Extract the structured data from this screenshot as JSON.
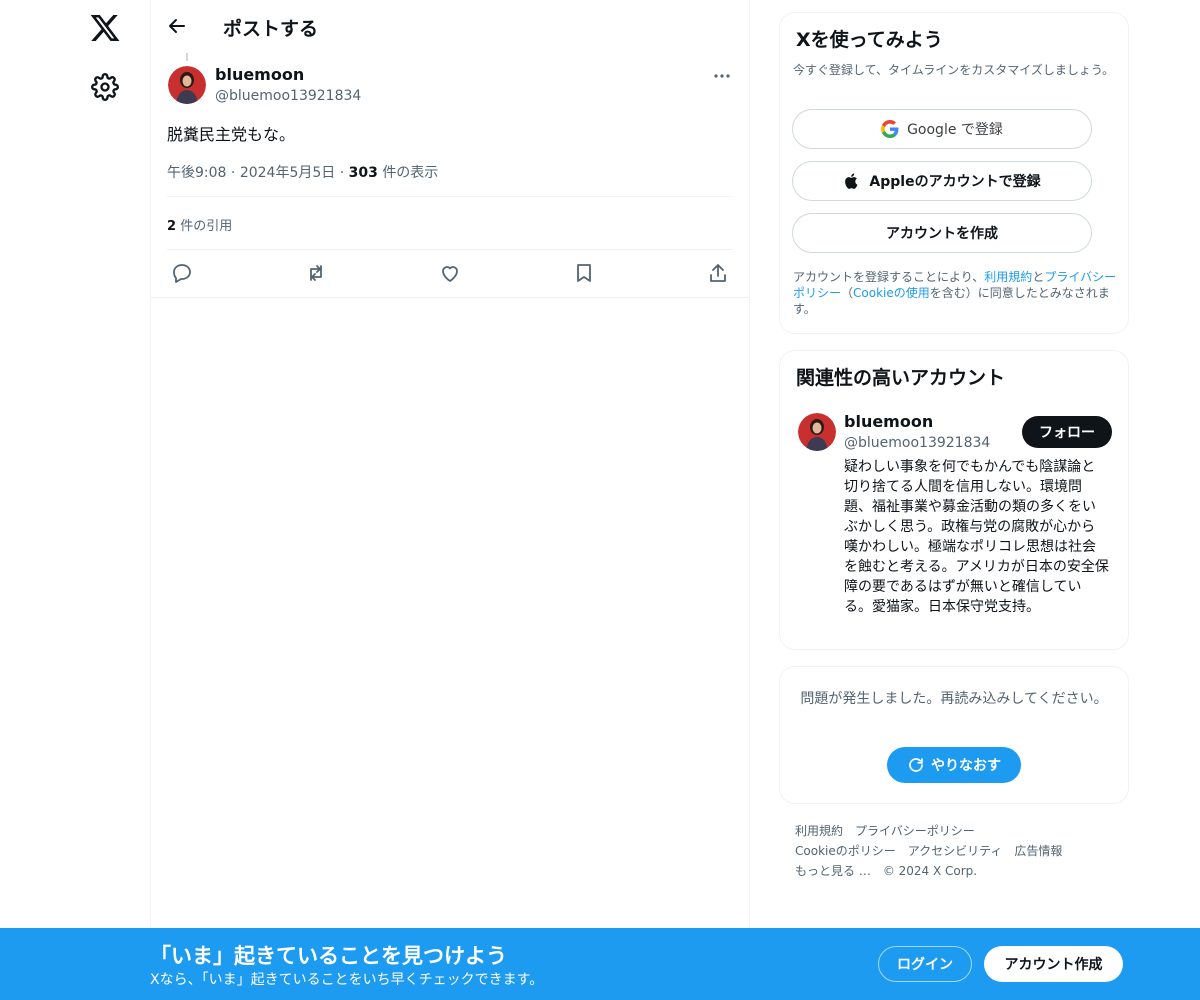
{
  "nav": {
    "logo_icon": "x-logo-icon",
    "settings_icon": "gear-icon"
  },
  "header": {
    "back_icon": "arrow-left-icon",
    "title": "ポストする"
  },
  "post": {
    "author_name": "bluemoon",
    "author_handle": "@bluemoo13921834",
    "text": "脱糞民主党もな。",
    "time": "午後9:08",
    "date": "2024年5月5日",
    "separator": "·",
    "views_count": "303",
    "views_label": "件の表示",
    "quotes_count": "2",
    "quotes_label": "件の引用",
    "action_icons": [
      "reply-icon",
      "retweet-icon",
      "like-icon",
      "bookmark-icon",
      "share-icon"
    ]
  },
  "signup_card": {
    "title": "Xを使ってみよう",
    "subtitle": "今すぐ登録して、タイムラインをカスタマイズしましょう。",
    "google_label": "Google で登録",
    "apple_label": "Appleのアカウントで登録",
    "create_label": "アカウントを作成",
    "legal_prefix": "アカウントを登録することにより、",
    "terms_link": "利用規約",
    "and": "と",
    "privacy_link": "プライバシーポリシー",
    "paren_open": "（",
    "cookie_link": "Cookieの使用",
    "legal_suffix": "を含む）に同意したとみなされます。"
  },
  "related_card": {
    "title": "関連性の高いアカウント",
    "name": "bluemoon",
    "handle": "@bluemoo13921834",
    "follow_label": "フォロー",
    "bio": "疑わしい事象を何でもかんでも陰謀論と切り捨てる人間を信用しない。環境問題、福祉事業や募金活動の類の多くをいぶかしく思う。政権与党の腐敗が心から嘆かわしい。極端なポリコレ思想は社会を蝕むと考える。アメリカが日本の安全保障の要であるはずが無いと確信している。愛猫家。日本保守党支持。"
  },
  "error_card": {
    "message": "問題が発生しました。再読み込みしてください。",
    "retry_label": "やりなおす"
  },
  "footer": {
    "links": [
      "利用規約",
      "プライバシーポリシー",
      "Cookieのポリシー",
      "アクセシビリティ",
      "広告情報",
      "もっと見る …"
    ],
    "copyright": "© 2024 X Corp."
  },
  "banner": {
    "title": "「いま」起きていることを見つけよう",
    "subtitle": "Xなら、「いま」起きていることをいち早くチェックできます。",
    "login_label": "ログイン",
    "signup_label": "アカウント作成"
  },
  "colors": {
    "accent": "#1d9bf0",
    "text_primary": "#0f1419",
    "text_secondary": "#536471",
    "border": "#eff3f4"
  }
}
